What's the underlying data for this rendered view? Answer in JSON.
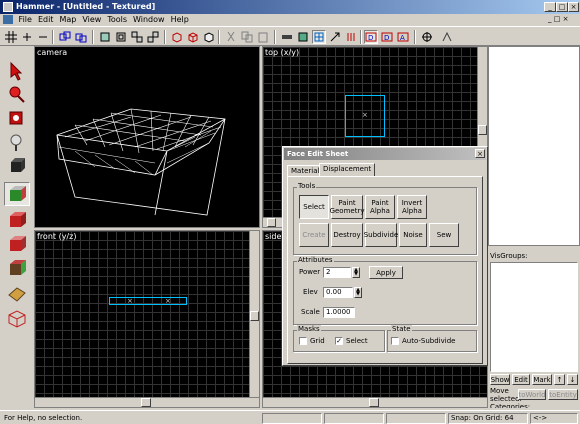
{
  "window": {
    "title": "Hammer - [Untitled - Textured]"
  },
  "menu": [
    "File",
    "Edit",
    "Map",
    "View",
    "Tools",
    "Window",
    "Help"
  ],
  "views": {
    "camera": "camera",
    "top": "top (x/y)",
    "front": "front (y/z)",
    "side": "side"
  },
  "right_panel": {
    "visgroups_label": "VisGroups:",
    "show": "Show",
    "edit": "Edit",
    "mark": "Mark",
    "up": "↑",
    "down": "↓",
    "move_selected": "Move selected:",
    "to_world": "toWorld",
    "to_entity": "toEntity",
    "categories": "Categories:"
  },
  "status": {
    "help": "For Help, no selection.",
    "snap": "Snap: On Grid: 64",
    "coords": "<->"
  },
  "dialog": {
    "title": "Face Edit Sheet",
    "tabs": [
      "Material",
      "Displacement"
    ],
    "tools_label": "Tools",
    "tools_row1": [
      "Select",
      "Paint Geometry",
      "Paint Alpha",
      "Invert Alpha"
    ],
    "tools_row2": [
      "Create",
      "Destroy",
      "Subdivide",
      "Noise",
      "Sew"
    ],
    "attributes_label": "Attributes",
    "power_label": "Power",
    "power_value": "2",
    "apply": "Apply",
    "elev_label": "Elev",
    "elev_value": "0.00",
    "scale_label": "Scale",
    "scale_value": "1.0000",
    "masks_label": "Masks",
    "grid_label": "Grid",
    "select_label": "Select",
    "state_label": "State",
    "autosub_label": "Auto-Subdivide",
    "mask_grid_checked": false,
    "mask_select_checked": true,
    "auto_subdivide_checked": false
  },
  "colors": {
    "title_active": "#0a246a",
    "selection": "#00c0ff",
    "wireframe": "#ffffff"
  }
}
